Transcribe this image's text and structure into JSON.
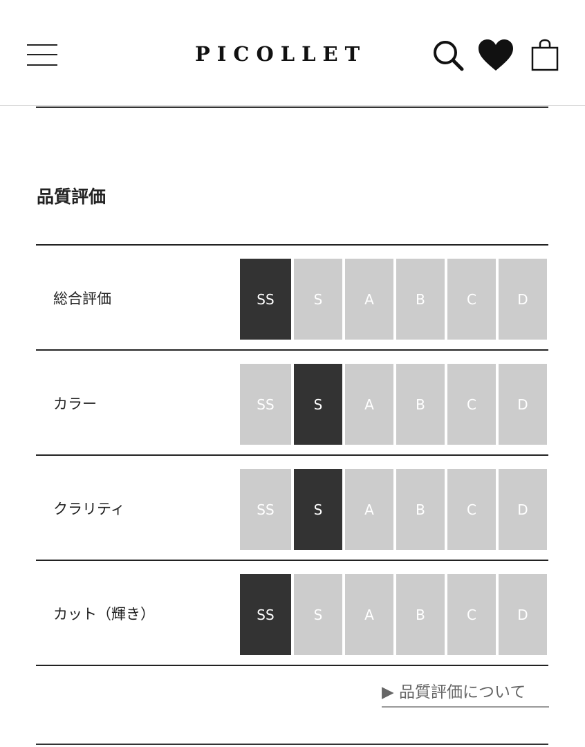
{
  "header": {
    "logo": "PICOLLET",
    "icons": [
      "menu-icon",
      "search-icon",
      "heart-icon",
      "shopping-bag-icon"
    ]
  },
  "quality": {
    "title": "品質評価",
    "grades": [
      "SS",
      "S",
      "A",
      "B",
      "C",
      "D"
    ],
    "rows": [
      {
        "label": "総合評価",
        "selected": "SS"
      },
      {
        "label": "カラー",
        "selected": "S"
      },
      {
        "label": "クラリティ",
        "selected": "S"
      },
      {
        "label": "カット（輝き）",
        "selected": "SS"
      }
    ],
    "link": {
      "arrow": "▶",
      "text": "品質評価について"
    }
  },
  "colors": {
    "selected": "#333333",
    "unselected": "#cccccc",
    "grade_text": "#ffffff"
  }
}
